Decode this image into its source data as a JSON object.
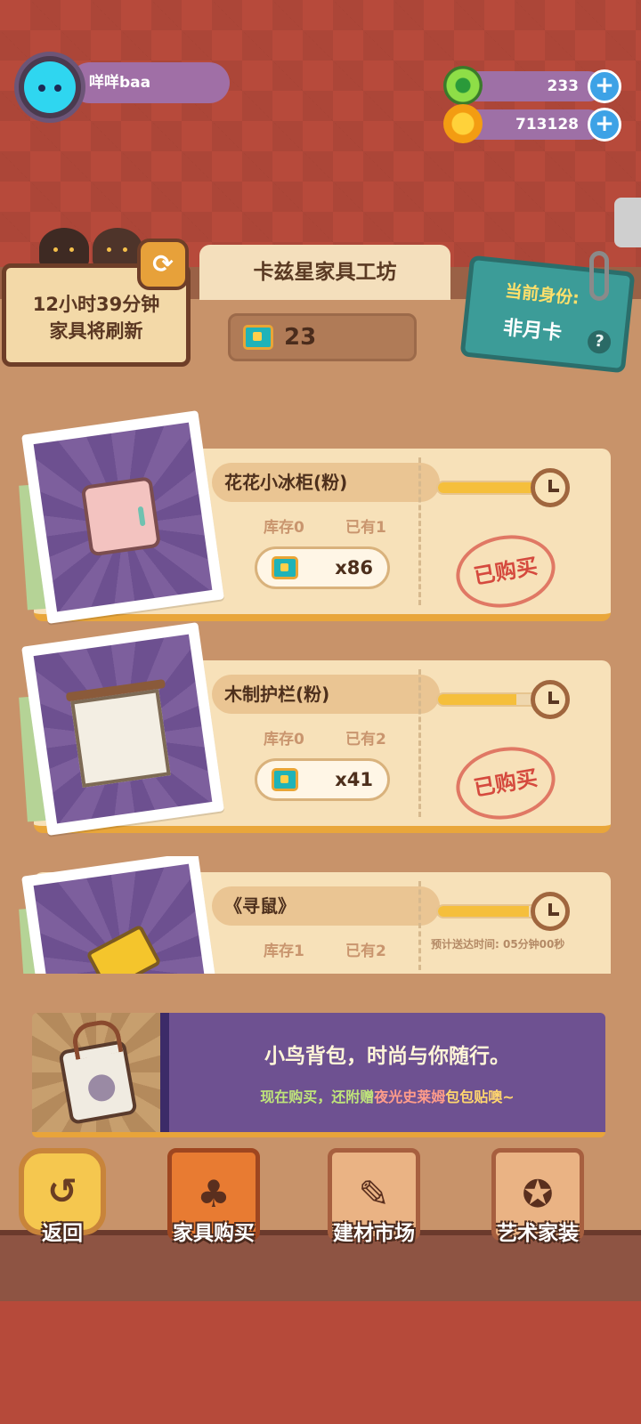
{
  "user": {
    "name": "咩咩baa"
  },
  "currencies": [
    {
      "icon": "green-gem-icon",
      "value": "233"
    },
    {
      "icon": "gold-coin-icon",
      "value": "713128"
    }
  ],
  "shop": {
    "title": "卡兹星家具工坊",
    "ticket_count": "23",
    "refresh_line1": "12小时39分钟",
    "refresh_line2": "家具将刷新",
    "identity_label": "当前身份:",
    "identity_value": "非月卡",
    "help": "?"
  },
  "items": [
    {
      "name": "花花小冰柜(粉)",
      "stock": "库存0",
      "owned": "已有1",
      "price": "x86",
      "status": "已购买",
      "progress": 0.75
    },
    {
      "name": "木制护栏(粉)",
      "stock": "库存0",
      "owned": "已有2",
      "price": "x41",
      "status": "已购买",
      "progress": 0.6
    },
    {
      "name": "《寻鼠》",
      "stock": "库存1",
      "owned": "已有2",
      "delivery": "预计送达时间: 05分钟00秒",
      "progress": 0.7
    }
  ],
  "ad": {
    "title": "小鸟背包，时尚与你随行。",
    "subtitle_a": "现在购买，还附赠",
    "subtitle_b": "夜光史莱姆",
    "subtitle_c": "包包贴噢~"
  },
  "nav": [
    {
      "label": "返回",
      "icon": "back-arrow-icon"
    },
    {
      "label": "家具购买",
      "icon": "furniture-icon"
    },
    {
      "label": "建材市场",
      "icon": "paint-brush-icon"
    },
    {
      "label": "艺术家装",
      "icon": "star-badge-icon"
    }
  ],
  "colors": {
    "accent": "#e9a63a",
    "panel": "#c8936a",
    "stamp": "#d54a3e"
  }
}
